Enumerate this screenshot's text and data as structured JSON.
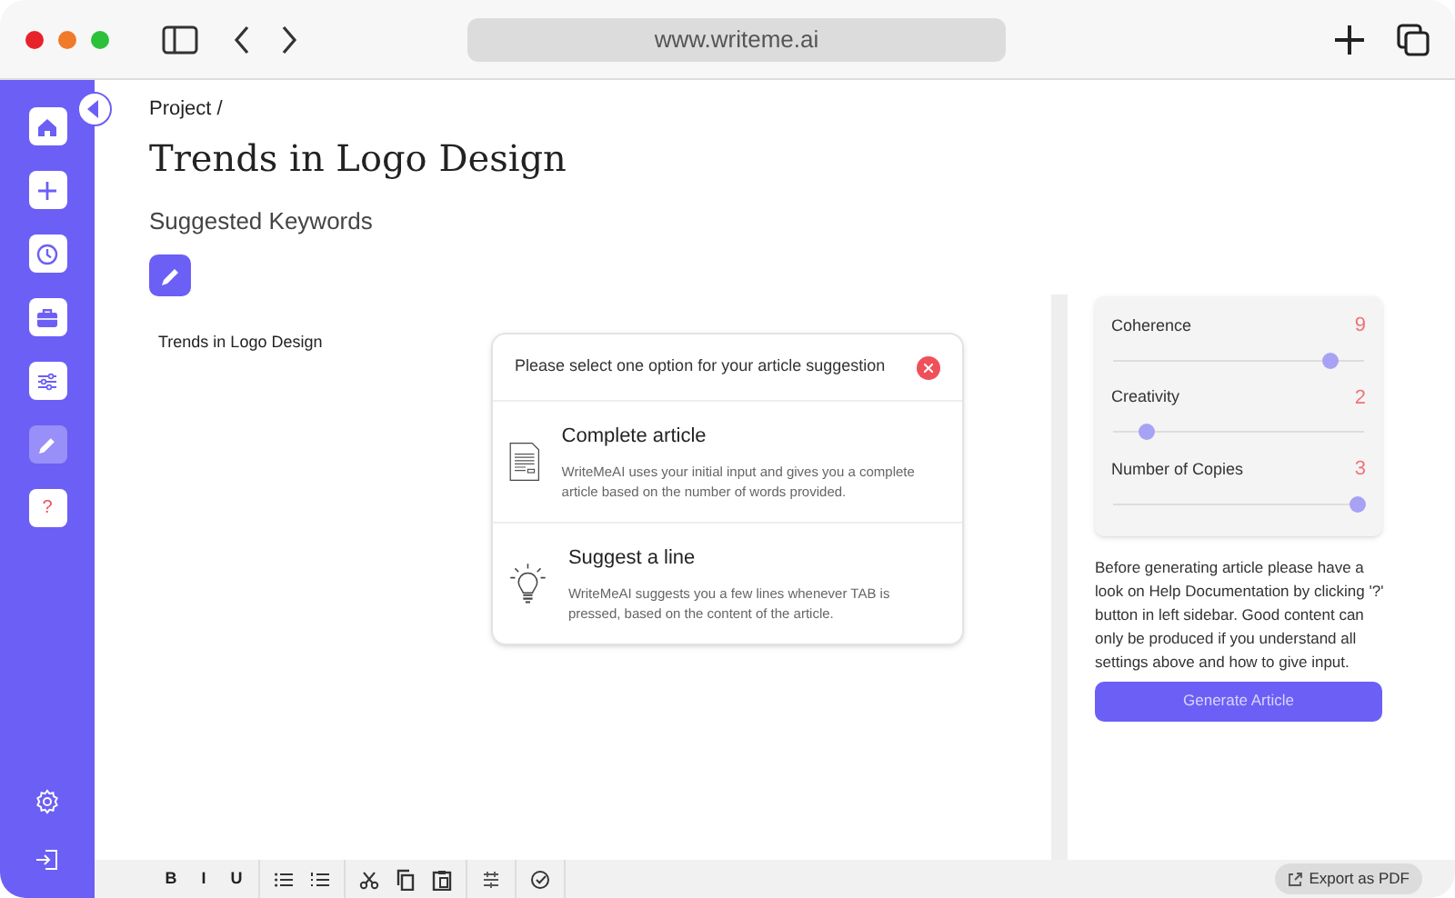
{
  "browser": {
    "url": "www.writeme.ai"
  },
  "sidebar": {
    "items": [
      {
        "kind": "home",
        "selected": false
      },
      {
        "kind": "plus",
        "selected": false
      },
      {
        "kind": "clock",
        "selected": false
      },
      {
        "kind": "briefcase",
        "selected": false
      },
      {
        "kind": "sliders",
        "selected": false
      },
      {
        "kind": "pencil",
        "selected": true
      },
      {
        "kind": "help",
        "label": "?",
        "selected": false
      }
    ],
    "bottom": [
      {
        "kind": "gear"
      },
      {
        "kind": "signin"
      }
    ]
  },
  "breadcrumb": "Project /",
  "title": "Trends in Logo Design",
  "keywords_label": "Suggested Keywords",
  "editor": {
    "text": "Trends in Logo Design"
  },
  "dialog": {
    "title": "Please select one option for your article suggestion",
    "options": [
      {
        "kind": "document",
        "title": "Complete article",
        "description": "WriteMeAI uses your initial input and gives you a complete article based on the number of words provided."
      },
      {
        "kind": "bulb",
        "title": "Suggest a line",
        "description": "WriteMeAI suggests you a few lines whenever TAB is pressed, based on the content of the article."
      }
    ]
  },
  "settings": [
    {
      "label": "Coherence",
      "value": "9",
      "level": 0.86
    },
    {
      "label": "Creativity",
      "value": "2",
      "level": 0.13
    },
    {
      "label": "Number of Copies",
      "value": "3",
      "level": 0.97
    }
  ],
  "help_text": "Before generating article please have a look on Help Documentation by clicking '?' button in left sidebar. Good content can only be produced if you understand all settings above and how to give input.",
  "generate_button": "Generate Article",
  "toolbar": [
    {
      "buttons": [
        {
          "kind": "text",
          "label": "B"
        },
        {
          "kind": "text",
          "label": "I"
        },
        {
          "kind": "text",
          "label": "U"
        }
      ]
    },
    {
      "buttons": [
        {
          "kind": "bullets"
        },
        {
          "kind": "numbers"
        }
      ]
    },
    {
      "buttons": [
        {
          "kind": "cut"
        },
        {
          "kind": "copy"
        },
        {
          "kind": "paste"
        }
      ]
    },
    {
      "buttons": [
        {
          "kind": "format"
        }
      ]
    },
    {
      "buttons": [
        {
          "kind": "check"
        }
      ]
    }
  ],
  "export_button": "Export as PDF"
}
